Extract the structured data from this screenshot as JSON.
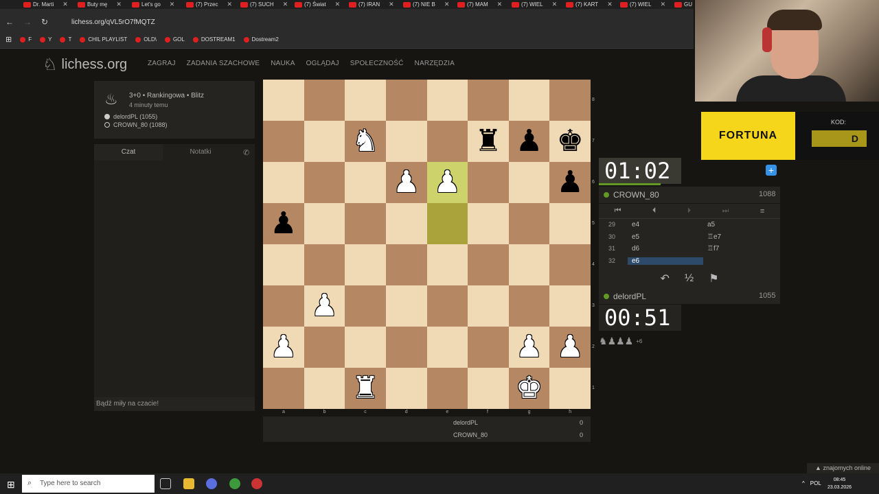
{
  "browser": {
    "tabs": [
      "Dr. Marti",
      "Buty mę",
      "Let's go",
      "(7) Przec",
      "(7) SUCH",
      "(7) Świat",
      "(7) IRAN",
      "(7) NIE B",
      "(7) MAM",
      "(7) WIEL",
      "(7) KART",
      "(7) WIEL",
      "GU"
    ],
    "url": "lichess.org/qVL5rO7fMQTZ",
    "bookmarks": [
      "F",
      "Y",
      "T",
      "CHIL PLAYLIST",
      "OLD\\",
      "GOL",
      "DOSTREAM1",
      "Dostream2"
    ]
  },
  "site": {
    "logo": "lichess.org",
    "nav": [
      "ZAGRAJ",
      "ZADANIA SZACHOWE",
      "NAUKA",
      "OGLĄDAJ",
      "SPOŁECZNOŚĆ",
      "NARZĘDZIA"
    ]
  },
  "game_info": {
    "title": "3+0 • Rankingowa • Blitz",
    "time_ago": "4 minuty temu",
    "player_white": "delordPL (1055)",
    "player_black": "CROWN_80 (1088)"
  },
  "chat": {
    "tab_chat": "Czat",
    "tab_notes": "Notatki",
    "placeholder": "Bądź miły na czacie!"
  },
  "board": {
    "ranks": [
      "8",
      "7",
      "6",
      "5",
      "4",
      "3",
      "2",
      "1"
    ],
    "files": [
      "a",
      "b",
      "c",
      "d",
      "e",
      "f",
      "g",
      "h"
    ],
    "position": [
      [
        "",
        "",
        "",
        "",
        "",
        "",
        "",
        ""
      ],
      [
        "",
        "",
        "N",
        "",
        "",
        "r",
        "p",
        "k"
      ],
      [
        "",
        "",
        "",
        "P",
        "P",
        "",
        "",
        "p"
      ],
      [
        "p",
        "",
        "",
        "",
        "",
        "",
        "",
        ""
      ],
      [
        "",
        "",
        "",
        "",
        "",
        "",
        "",
        ""
      ],
      [
        "",
        "P",
        "",
        "",
        "",
        "",
        "",
        ""
      ],
      [
        "P",
        "",
        "",
        "",
        "",
        "",
        "P",
        "P"
      ],
      [
        "",
        "",
        "R",
        "",
        "",
        "",
        "K",
        ""
      ]
    ]
  },
  "score": {
    "p1_name": "delordPL",
    "p1_score": "0",
    "p2_name": "CROWN_80",
    "p2_score": "0"
  },
  "clocks": {
    "top": "01:02",
    "bottom": "00:51"
  },
  "top_player": {
    "name": "CROWN_80",
    "rating": "1088"
  },
  "bottom_player": {
    "name": "delordPL",
    "rating": "1055"
  },
  "moves": [
    {
      "num": "29",
      "white": "e4",
      "black": "a5"
    },
    {
      "num": "30",
      "white": "e5",
      "black": "♖e7"
    },
    {
      "num": "31",
      "white": "d6",
      "black": "♖f7"
    },
    {
      "num": "32",
      "white": "e6",
      "black": ""
    }
  ],
  "material_adv": "+6",
  "ad": {
    "brand": "FORTUNA",
    "kod_label": "KOD:",
    "kod_value": "D"
  },
  "friends_online": "znajomych online",
  "taskbar": {
    "search_placeholder": "Type here to search",
    "lang": "POL",
    "time": "08:45",
    "date": "23.03.2026"
  },
  "colors": {
    "bg": "#161512",
    "board_light": "#f0d9b5",
    "board_dark": "#b58863",
    "last_move": "#aaa23a",
    "online": "#629924"
  }
}
